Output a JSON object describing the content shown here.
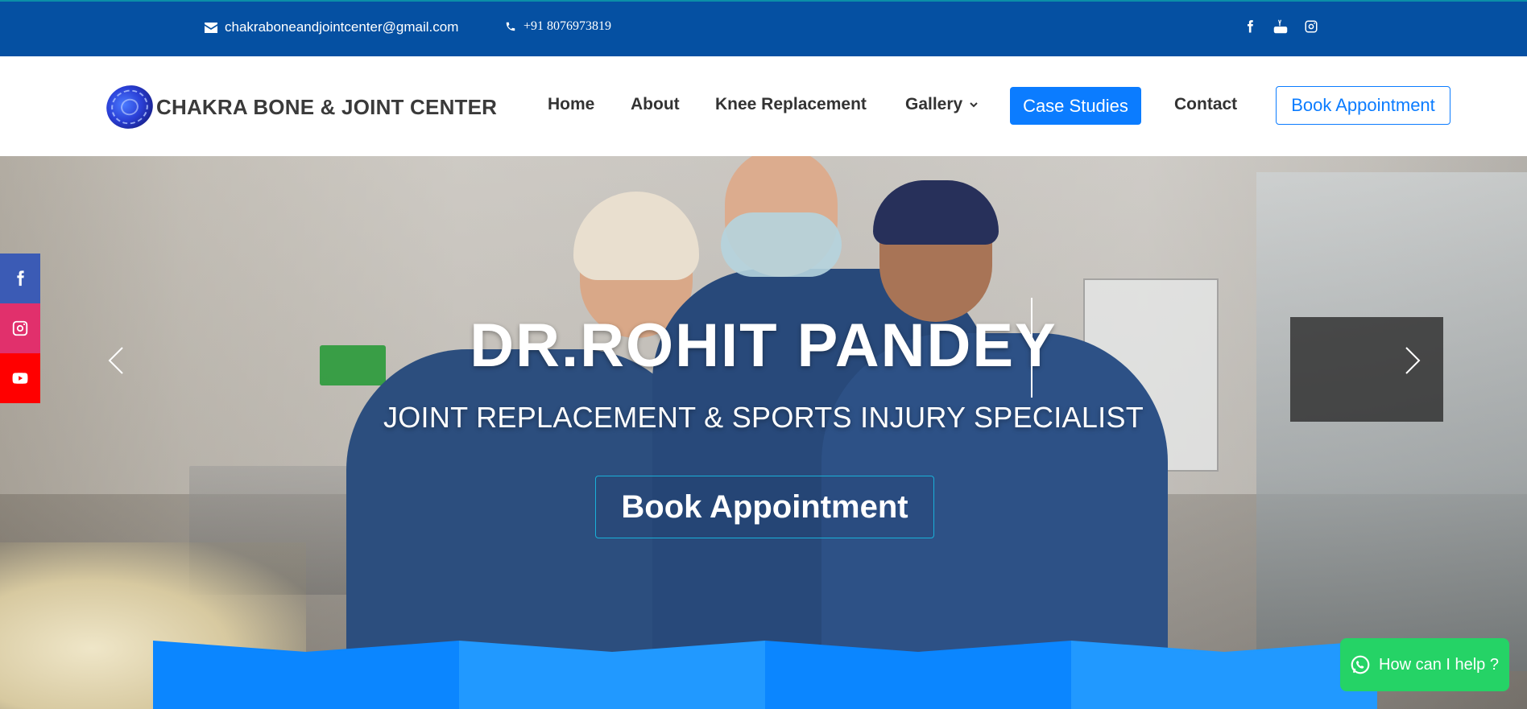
{
  "topbar": {
    "email": "chakraboneandjointcenter@gmail.com",
    "phone": "+91  8076973819",
    "socials": [
      "facebook-icon",
      "youtube-icon",
      "instagram-icon"
    ]
  },
  "header": {
    "logo_text": "CHAKRA BONE & JOINT CENTER",
    "nav": {
      "home": "Home",
      "about": "About",
      "knee": "Knee Replacement",
      "gallery": "Gallery",
      "case_studies": "Case Studies",
      "contact": "Contact",
      "book": "Book Appointment"
    }
  },
  "hero": {
    "title": "DR.ROHIT PANDEY",
    "subtitle": "JOINT REPLACEMENT & SPORTS INJURY SPECIALIST",
    "cta": "Book Appointment"
  },
  "side_social": [
    "facebook-icon",
    "instagram-icon",
    "youtube-icon"
  ],
  "help_widget": {
    "label": "How can I help ?"
  },
  "colors": {
    "topbar": "#0550a2",
    "primary": "#0b7cff",
    "whatsapp": "#25d366",
    "facebook": "#3b5bb5",
    "instagram": "#e1306c",
    "youtube": "#ff0000"
  }
}
